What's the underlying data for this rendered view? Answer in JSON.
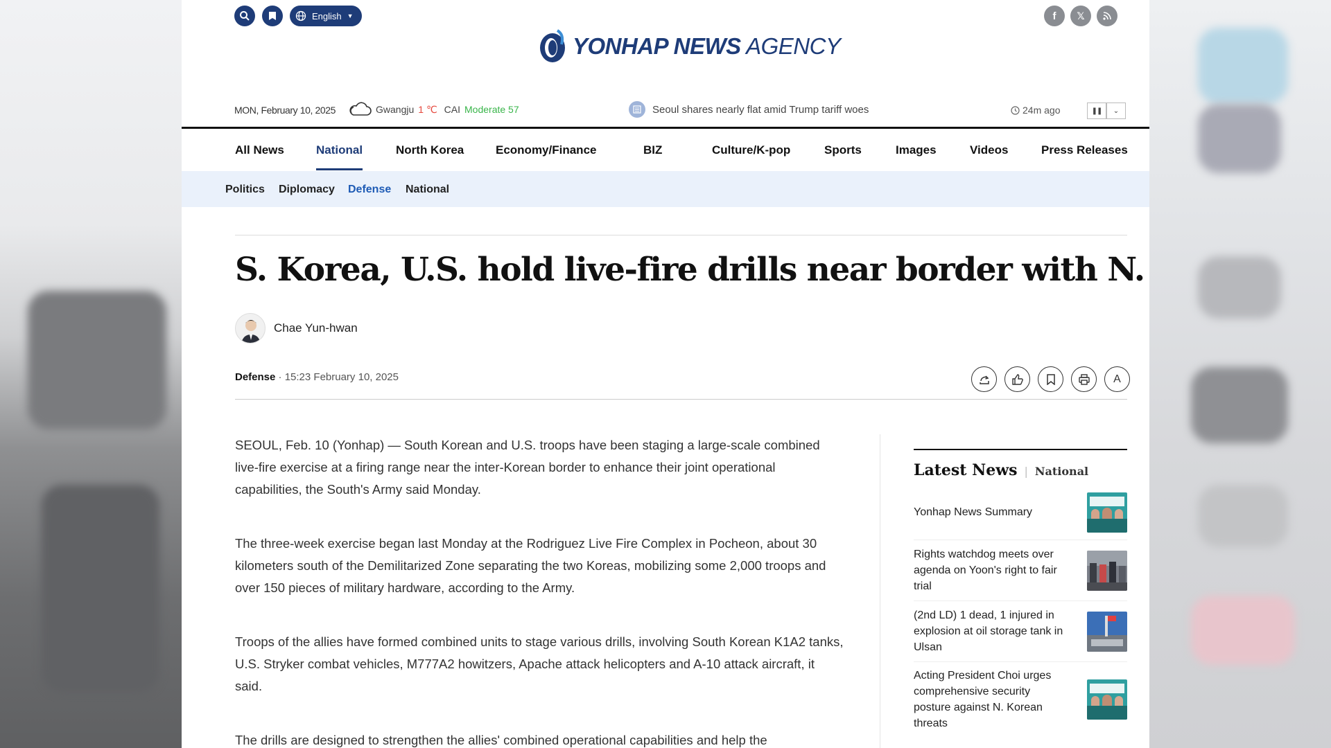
{
  "header": {
    "language_label": "English",
    "logo_text_bold": "YONHAP NEWS",
    "logo_text_light": "AGENCY",
    "social": [
      "facebook-icon",
      "x-icon",
      "rss-icon"
    ]
  },
  "infobar": {
    "date": "MON, February 10, 2025",
    "city": "Gwangju",
    "temperature": "1 ℃",
    "cai_label": "CAI",
    "cai_value": "Moderate 57",
    "ticker_headline": "Seoul shares nearly flat amid Trump tariff woes",
    "ticker_time": "24m ago"
  },
  "nav": {
    "items": [
      "All News",
      "National",
      "North Korea",
      "Economy/Finance",
      "BIZ",
      "Culture/K-pop",
      "Sports",
      "Images",
      "Videos",
      "Press Releases"
    ],
    "active": "National"
  },
  "subnav": {
    "items": [
      "Politics",
      "Diplomacy",
      "Defense",
      "National"
    ],
    "active": "Defense"
  },
  "article": {
    "headline": "S. Korea, U.S. hold live-fire drills near border with N. Korea",
    "author": "Chae Yun-hwan",
    "category": "Defense",
    "timestamp": "15:23 February 10, 2025",
    "paragraphs": [
      "SEOUL, Feb. 10 (Yonhap) — South Korean and U.S. troops have been staging a large-scale combined live-fire exercise at a firing range near the inter-Korean border to enhance their joint operational capabilities, the South's Army said Monday.",
      "The three-week exercise began last Monday at the Rodriguez Live Fire Complex in Pocheon, about 30 kilometers south of the Demilitarized Zone separating the two Koreas, mobilizing some 2,000 troops and over 150 pieces of military hardware, according to the Army.",
      "Troops of the allies have formed combined units to stage various drills, involving South Korean K1A2 tanks, U.S. Stryker combat vehicles, M777A2 howitzers, Apache attack helicopters and A-10 attack aircraft, it said.",
      "The drills are designed to strengthen the allies' combined operational capabilities and help the"
    ],
    "actions": [
      "share-icon",
      "like-icon",
      "bookmark-icon",
      "print-icon",
      "font-size-icon"
    ]
  },
  "latest": {
    "title": "Latest News",
    "category": "National",
    "items": [
      "Yonhap News Summary",
      "Rights watchdog meets over agenda on Yoon's right to fair trial",
      "(2nd LD) 1 dead, 1 injured in explosion at oil storage tank in Ulsan",
      "Acting President Choi urges comprehensive security posture against N. Korean threats"
    ]
  },
  "colors": {
    "brand": "#1e3c78",
    "active_sub": "#1e5bb5",
    "temperature": "#e5473c",
    "cai_good": "#39b54a"
  }
}
